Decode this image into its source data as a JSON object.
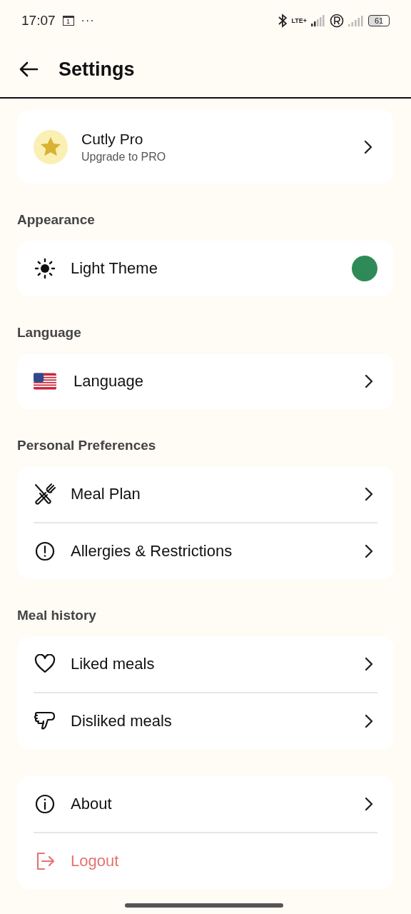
{
  "status_bar": {
    "time": "17:07",
    "calendar_day": "1",
    "overflow": "···",
    "network": "LTE+",
    "battery": "61"
  },
  "header": {
    "title": "Settings"
  },
  "pro_card": {
    "title": "Cutly Pro",
    "subtitle": "Upgrade to PRO"
  },
  "sections": [
    {
      "title": "Appearance",
      "items": [
        {
          "kind": "toggle",
          "label": "Light Theme",
          "on": true
        }
      ]
    },
    {
      "title": "Language",
      "items": [
        {
          "kind": "nav",
          "label": "Language"
        }
      ]
    },
    {
      "title": "Personal Preferences",
      "items": [
        {
          "kind": "nav",
          "label": "Meal Plan"
        },
        {
          "kind": "nav",
          "label": "Allergies & Restrictions"
        }
      ]
    },
    {
      "title": "Meal history",
      "items": [
        {
          "kind": "nav",
          "label": "Liked meals"
        },
        {
          "kind": "nav",
          "label": "Disliked meals"
        }
      ]
    },
    {
      "items": [
        {
          "kind": "nav",
          "label": "About"
        },
        {
          "kind": "logout",
          "label": "Logout"
        }
      ]
    }
  ]
}
